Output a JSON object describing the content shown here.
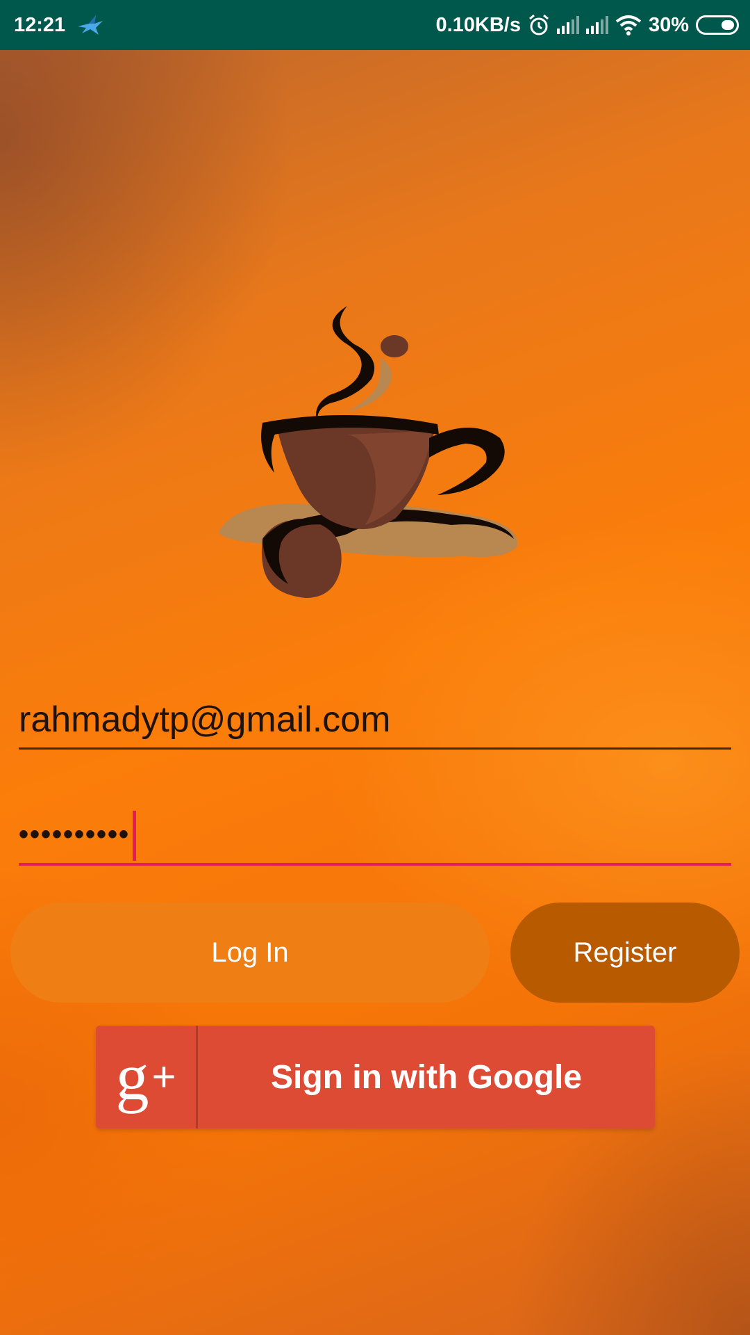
{
  "status_bar": {
    "time": "12:21",
    "network_speed": "0.10KB/s",
    "battery": "30%",
    "icons": [
      "bird-notification-icon",
      "alarm-icon",
      "signal-icon",
      "signal-icon",
      "wifi-icon",
      "battery-icon"
    ]
  },
  "logo": {
    "icon": "coffee-cup-logo"
  },
  "login_form": {
    "email_value": "rahmadytp@gmail.com",
    "password_value": "••••••••••",
    "login_label": "Log In",
    "register_label": "Register",
    "google_label": "Sign in with Google",
    "google_icon_text": "g",
    "google_icon_plus": "+"
  },
  "colors": {
    "status_bar": "#00574b",
    "login_button": "#ef7e14",
    "register_button": "#b75a00",
    "google_button": "#dd4b35",
    "focus_accent": "#e51b5b"
  }
}
